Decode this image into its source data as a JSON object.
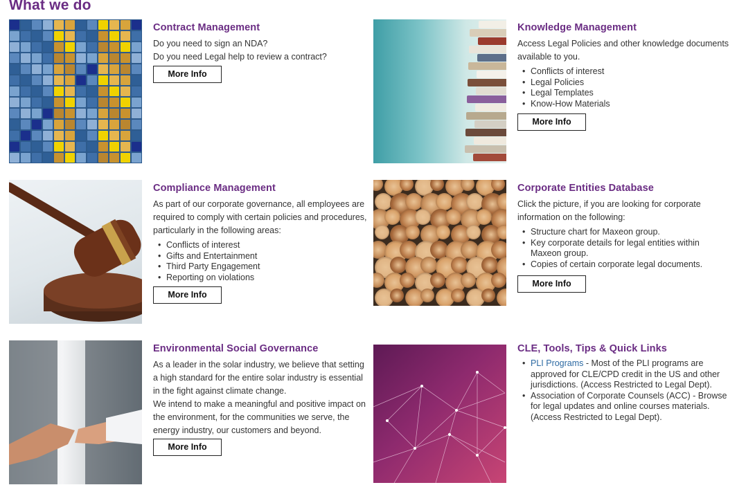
{
  "page": {
    "title": "What we do"
  },
  "colors": {
    "heading": "#6a2c83",
    "link": "#2d6aa3",
    "text": "#333333"
  },
  "cards": [
    {
      "title": "Contract Management",
      "paragraphs": [
        "Do you need to sign an NDA?",
        "Do you need Legal help to review a contract?"
      ],
      "button": "More Info",
      "image": "mosaic-tiles-image"
    },
    {
      "title": "Knowledge Management",
      "paragraphs": [
        "Access Legal Policies and other knowledge documents available to you."
      ],
      "items": [
        "Conflicts of interest",
        "Legal Policies",
        "Legal Templates",
        "Know-How Materials"
      ],
      "button": "More Info",
      "image": "book-stack-image"
    },
    {
      "title": "Compliance Management",
      "paragraphs": [
        "As part of our corporate governance, all employees are required to comply with certain policies and procedures, particularly in the following areas:"
      ],
      "items": [
        "Conflicts of interest",
        "Gifts and Entertainment",
        "Third Party Engagement",
        "Reporting on violations"
      ],
      "button": "More Info",
      "image": "gavel-image"
    },
    {
      "title": "Corporate Entities Database",
      "paragraphs": [
        "Click the picture, if you are looking for corporate information on the following:"
      ],
      "items": [
        "Structure chart for Maxeon group.",
        "Key corporate details for legal entities within Maxeon group.",
        "Copies of certain corporate legal documents."
      ],
      "button": "More Info",
      "image": "log-pile-image"
    },
    {
      "title": "Environmental Social Governance",
      "paragraphs": [
        "As a leader in the solar industry, we believe that setting a high standard for the entire solar industry is essential in the fight against climate change.",
        "We intend to make a meaningful and positive impact on the environment, for the communities we serve, the energy industry, our customers and beyond."
      ],
      "button": "More Info",
      "image": "handshake-image"
    },
    {
      "title": "CLE, Tools, Tips & Quick Links",
      "links": [
        {
          "link": "PLI Programs",
          "text": " - Most of the PLI programs are approved for CLE/CPD credit in the US and other jurisdictions. (Access Restricted to Legal Dept)."
        },
        {
          "link": "",
          "text": "Association of Corporate Counsels (ACC) - Browse for legal updates and online courses materials. (Access Restricted to Legal Dept)."
        }
      ],
      "image": "network-image"
    }
  ]
}
